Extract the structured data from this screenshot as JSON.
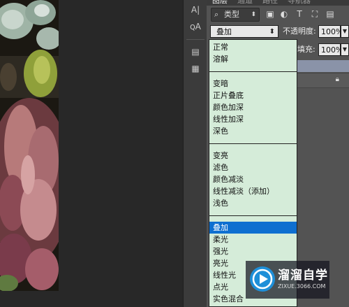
{
  "panel": {
    "tabs": [
      "图层",
      "通道",
      "路径",
      "导航器"
    ],
    "filter": {
      "label": "类型",
      "icon": "search-icon"
    },
    "blend_mode": {
      "value": "叠加"
    },
    "opacity": {
      "label": "不透明度:",
      "value": "100%"
    },
    "fill": {
      "label": "填充:",
      "value": "100%"
    }
  },
  "tools": [
    "character-icon",
    "paragraph-icon",
    "layer-comp-icon",
    "note-icon"
  ],
  "blend_list": {
    "groups": [
      [
        "正常",
        "溶解"
      ],
      [
        "变暗",
        "正片叠底",
        "颜色加深",
        "线性加深",
        "深色"
      ],
      [
        "变亮",
        "滤色",
        "颜色减淡",
        "线性减淡（添加）",
        "浅色"
      ],
      [
        "叠加",
        "柔光",
        "强光",
        "亮光",
        "线性光",
        "点光",
        "实色混合"
      ]
    ],
    "selected": "叠加"
  },
  "watermark": {
    "title": "溜溜自学",
    "url": "ZIXUE.3066.COM"
  },
  "colors": {
    "list_bg": "#d5ecd9",
    "selection": "#0e6fd0",
    "panel_bg": "#535353"
  }
}
